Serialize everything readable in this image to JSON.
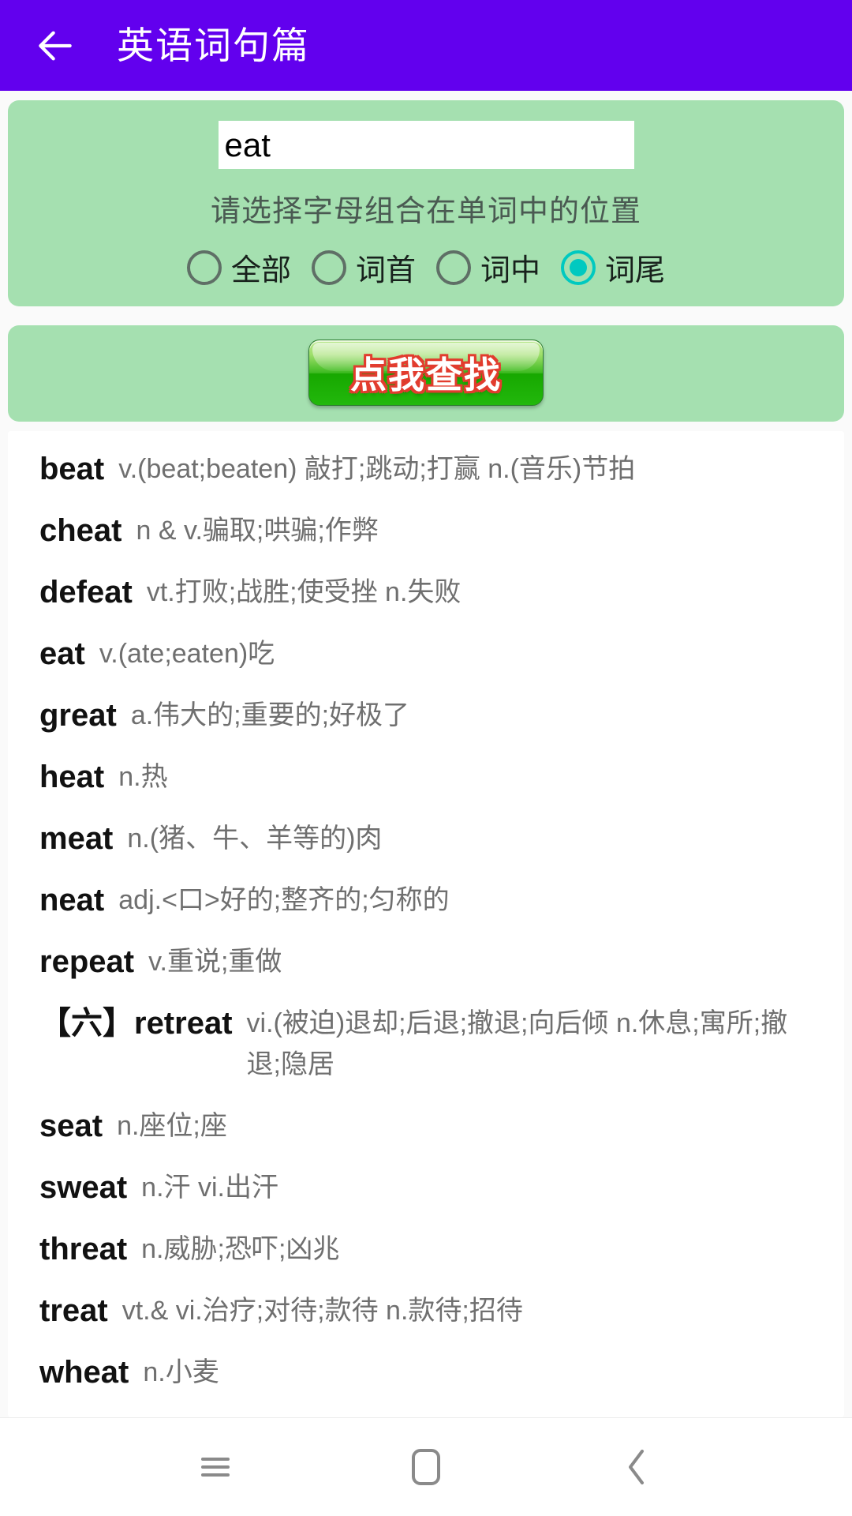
{
  "appbar": {
    "back_icon": "arrow-left-icon",
    "title": "英语词句篇",
    "background": "#6200EE"
  },
  "search_panel": {
    "background": "#A5E0B0",
    "input": {
      "value": "eat",
      "placeholder": ""
    },
    "hint": "请选择字母组合在单词中的位置",
    "selected_index": 3,
    "accent_color": "#00C9C0",
    "options": [
      {
        "label": "全部",
        "checked": false
      },
      {
        "label": "词首",
        "checked": false
      },
      {
        "label": "词中",
        "checked": false
      },
      {
        "label": "词尾",
        "checked": true
      }
    ]
  },
  "action_panel": {
    "button_label": "点我查找"
  },
  "results": [
    {
      "word": "beat",
      "definition": "v.(beat;beaten) 敲打;跳动;打赢 n.(音乐)节拍"
    },
    {
      "word": "cheat",
      "definition": "n & v.骗取;哄骗;作弊"
    },
    {
      "word": "defeat",
      "definition": "vt.打败;战胜;使受挫 n.失败"
    },
    {
      "word": "eat",
      "definition": "v.(ate;eaten)吃"
    },
    {
      "word": "great",
      "definition": "a.伟大的;重要的;好极了"
    },
    {
      "word": "heat",
      "definition": "n.热"
    },
    {
      "word": "meat",
      "definition": "n.(猪、牛、羊等的)肉"
    },
    {
      "word": "neat",
      "definition": "adj.<口>好的;整齐的;匀称的"
    },
    {
      "word": "repeat",
      "definition": "v.重说;重做"
    },
    {
      "word": "【六】retreat",
      "definition": "vi.(被迫)退却;后退;撤退;向后倾 n.休息;寓所;撤退;隐居"
    },
    {
      "word": "seat",
      "definition": "n.座位;座"
    },
    {
      "word": "sweat",
      "definition": "n.汗 vi.出汗"
    },
    {
      "word": "threat",
      "definition": "n.威胁;恐吓;凶兆"
    },
    {
      "word": "treat",
      "definition": "vt.& vi.治疗;对待;款待 n.款待;招待"
    },
    {
      "word": "wheat",
      "definition": "n.小麦"
    }
  ],
  "navbar": {
    "menu_icon": "menu-icon",
    "home_icon": "home-square-icon",
    "back_icon": "chevron-left-icon"
  }
}
